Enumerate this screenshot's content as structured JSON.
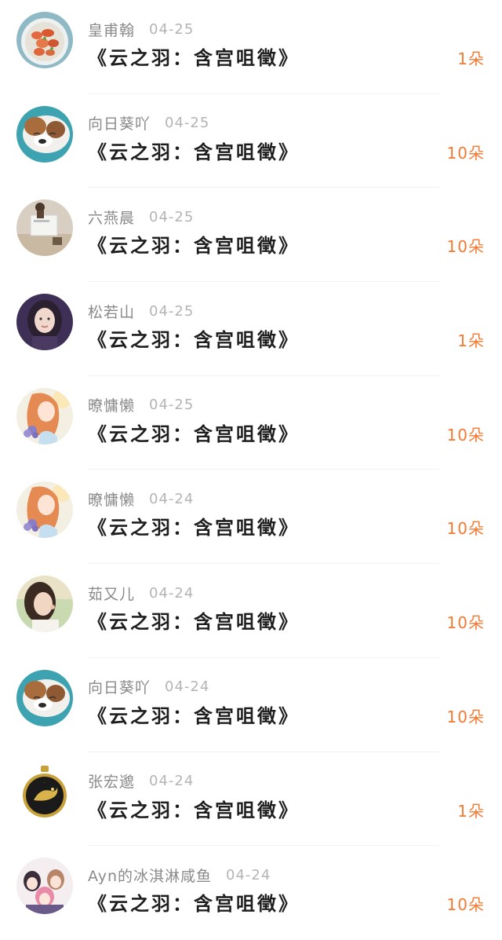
{
  "gift_list": {
    "items": [
      {
        "name": "皇甫翰",
        "date": "04-25",
        "title": "《云之羽：含宫咀徵》",
        "gift": "1朵",
        "avatar": "food-avatar"
      },
      {
        "name": "向日葵吖",
        "date": "04-25",
        "title": "《云之羽：含宫咀徵》",
        "gift": "10朵",
        "avatar": "dog-avatar"
      },
      {
        "name": "六燕晨",
        "date": "04-25",
        "title": "《云之羽：含宫咀徵》",
        "gift": "10朵",
        "avatar": "photo-avatar"
      },
      {
        "name": "松若山",
        "date": "04-25",
        "title": "《云之羽：含宫咀徵》",
        "gift": "1朵",
        "avatar": "girl-avatar"
      },
      {
        "name": "暸慵懒",
        "date": "04-25",
        "title": "《云之羽：含宫咀徵》",
        "gift": "10朵",
        "avatar": "anime-girl-avatar"
      },
      {
        "name": "暸慵懒",
        "date": "04-24",
        "title": "《云之羽：含宫咀徵》",
        "gift": "10朵",
        "avatar": "anime-girl-avatar"
      },
      {
        "name": "茹又儿",
        "date": "04-24",
        "title": "《云之羽：含宫咀徵》",
        "gift": "10朵",
        "avatar": "portrait-avatar"
      },
      {
        "name": "向日葵吖",
        "date": "04-24",
        "title": "《云之羽：含宫咀徵》",
        "gift": "10朵",
        "avatar": "dog-avatar"
      },
      {
        "name": "张宏邈",
        "date": "04-24",
        "title": "《云之羽：含宫咀徵》",
        "gift": "1朵",
        "avatar": "tiger-emblem-avatar"
      },
      {
        "name": "Ayn的冰淇淋咸鱼",
        "date": "04-24",
        "title": "《云之羽：含宫咀徵》",
        "gift": "10朵",
        "avatar": "anime-group-avatar"
      }
    ]
  },
  "colors": {
    "name": "#8a8a8a",
    "date": "#b4b4b4",
    "title": "#1e1e1e",
    "gift": "#f47a33",
    "divider": "#f2f2f2"
  }
}
